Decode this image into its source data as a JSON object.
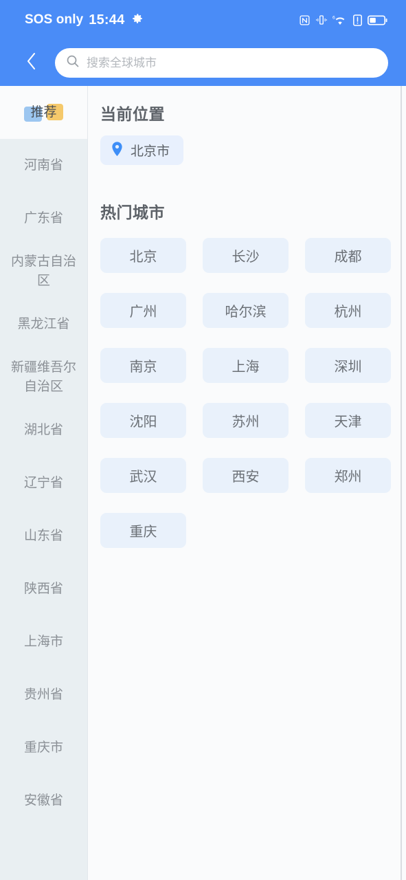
{
  "statusbar": {
    "carrier": "SOS only",
    "time": "15:44",
    "icons": [
      "gear-icon",
      "nfc-icon",
      "vibrate-icon",
      "wifi-6-icon",
      "alert-icon",
      "battery-icon"
    ]
  },
  "header": {
    "back_icon": "chevron-left-icon",
    "search": {
      "icon": "search-icon",
      "value": "",
      "placeholder": "搜索全球城市"
    }
  },
  "sidebar": {
    "active_index": 0,
    "items": [
      {
        "label": "推荐"
      },
      {
        "label": "河南省"
      },
      {
        "label": "广东省"
      },
      {
        "label": "内蒙古自治区"
      },
      {
        "label": "黑龙江省"
      },
      {
        "label": "新疆维吾尔自治区"
      },
      {
        "label": "湖北省"
      },
      {
        "label": "辽宁省"
      },
      {
        "label": "山东省"
      },
      {
        "label": "陕西省"
      },
      {
        "label": "上海市"
      },
      {
        "label": "贵州省"
      },
      {
        "label": "重庆市"
      },
      {
        "label": "安徽省"
      }
    ]
  },
  "main": {
    "current_location": {
      "title": "当前位置",
      "pin_icon": "location-pin-icon",
      "city": "北京市"
    },
    "hot_cities": {
      "title": "热门城市",
      "cities": [
        "北京",
        "长沙",
        "成都",
        "广州",
        "哈尔滨",
        "杭州",
        "南京",
        "上海",
        "深圳",
        "沈阳",
        "苏州",
        "天津",
        "武汉",
        "西安",
        "郑州",
        "重庆"
      ]
    }
  },
  "colors": {
    "brand_blue": "#4a8cf7",
    "sidebar_bg": "#e9eff2",
    "chip_bg": "#e9f1fb",
    "page_bg": "#fafbfc",
    "highlight_blue": "#9cc6f0",
    "highlight_yellow": "#f5c96b",
    "text_primary": "#5d6268",
    "text_muted": "#8b9096"
  }
}
